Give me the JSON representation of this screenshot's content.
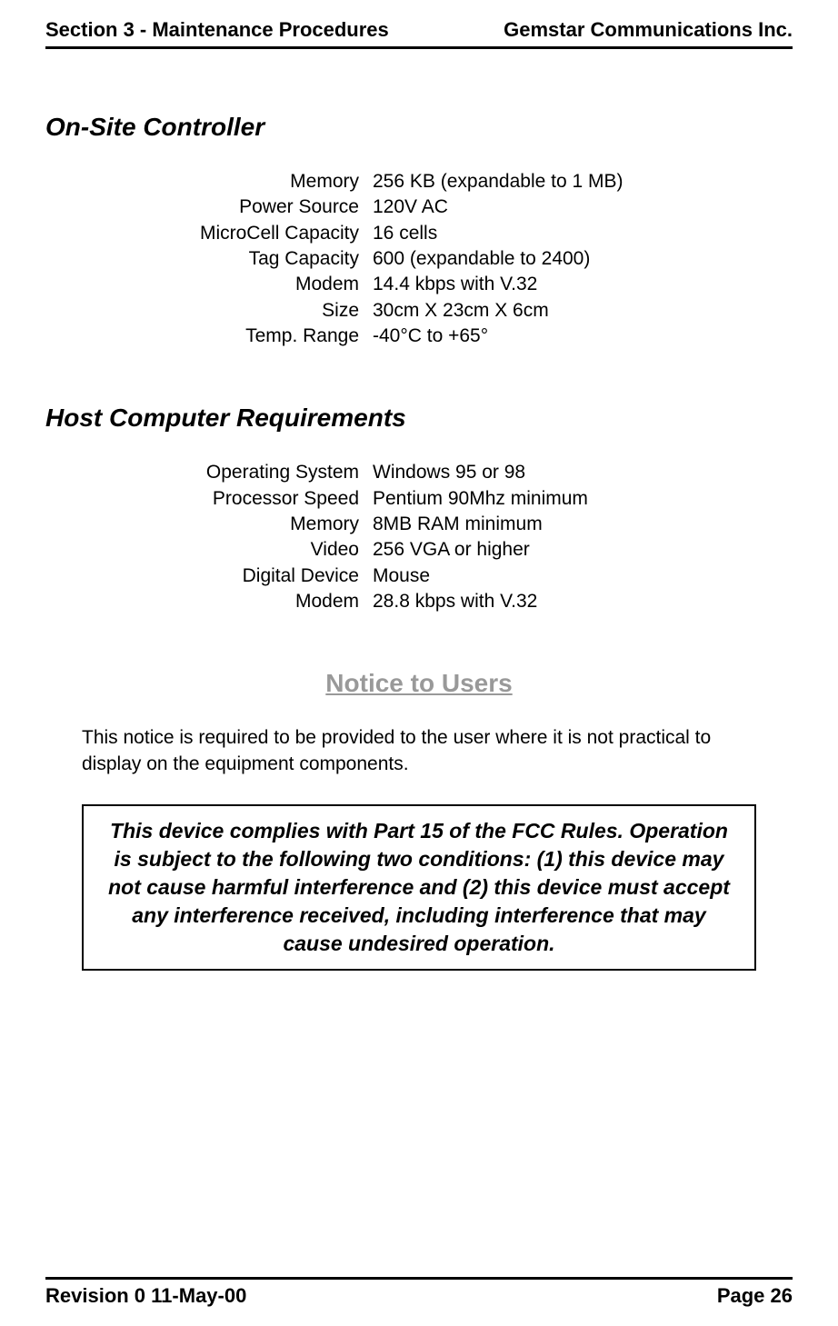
{
  "header": {
    "left": "Section 3 - Maintenance Procedures",
    "right": "Gemstar Communications Inc."
  },
  "section1": {
    "heading": "On-Site Controller",
    "specs": [
      {
        "label": "Memory",
        "value": "256 KB (expandable to 1 MB)"
      },
      {
        "label": "Power Source",
        "value": "120V AC"
      },
      {
        "label": "MicroCell Capacity",
        "value": "16 cells"
      },
      {
        "label": "Tag Capacity",
        "value": "600 (expandable to 2400)"
      },
      {
        "label": "Modem",
        "value": "14.4 kbps with V.32"
      },
      {
        "label": "Size",
        "value": "30cm X 23cm X 6cm"
      },
      {
        "label": "Temp. Range",
        "value": "-40°C to +65°"
      }
    ]
  },
  "section2": {
    "heading": "Host Computer Requirements",
    "specs": [
      {
        "label": "Operating System",
        "value": "Windows 95 or 98"
      },
      {
        "label": "Processor Speed",
        "value": "Pentium 90Mhz minimum"
      },
      {
        "label": "Memory",
        "value": "8MB RAM minimum"
      },
      {
        "label": "Video",
        "value": "256 VGA or higher"
      },
      {
        "label": "Digital Device",
        "value": "Mouse"
      },
      {
        "label": "Modem",
        "value": "28.8 kbps with V.32"
      }
    ]
  },
  "notice": {
    "heading": "Notice to Users",
    "intro": "This notice is required to be provided to the user where it is not practical to display on the equipment components.",
    "box": "This device complies with Part 15 of the FCC Rules. Operation is subject to the following two conditions: (1) this device may not cause harmful interference and (2) this device must accept any interference received, including interference that may cause undesired operation."
  },
  "footer": {
    "left": "Revision 0  11-May-00",
    "right": "Page 26"
  }
}
